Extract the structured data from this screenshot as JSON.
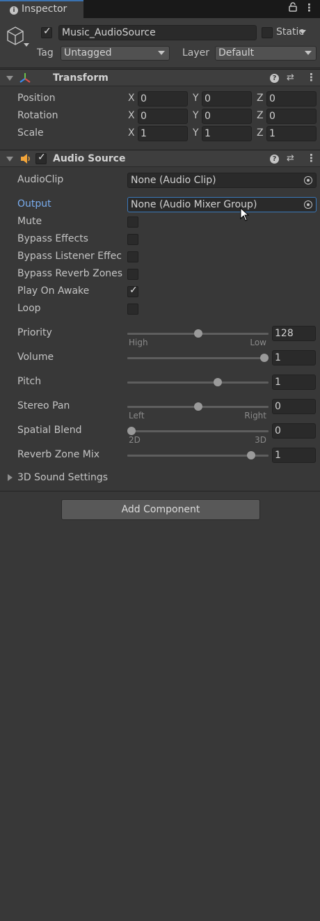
{
  "tab": {
    "title": "Inspector"
  },
  "header": {
    "object_name": "Music_AudioSource",
    "active": true,
    "static_label": "Static",
    "static_checked": false,
    "tag_label": "Tag",
    "tag_value": "Untagged",
    "layer_label": "Layer",
    "layer_value": "Default"
  },
  "transform": {
    "title": "Transform",
    "rows": [
      {
        "label": "Position",
        "x": "0",
        "y": "0",
        "z": "0"
      },
      {
        "label": "Rotation",
        "x": "0",
        "y": "0",
        "z": "0"
      },
      {
        "label": "Scale",
        "x": "1",
        "y": "1",
        "z": "1"
      }
    ],
    "axes": {
      "x": "X",
      "y": "Y",
      "z": "Z"
    }
  },
  "audio_source": {
    "title": "Audio Source",
    "enabled": true,
    "audio_clip": {
      "label": "AudioClip",
      "value": "None (Audio Clip)"
    },
    "output": {
      "label": "Output",
      "value": "None (Audio Mixer Group)"
    },
    "toggles": [
      {
        "label": "Mute",
        "checked": false
      },
      {
        "label": "Bypass Effects",
        "checked": false
      },
      {
        "label": "Bypass Listener Effec",
        "checked": false
      },
      {
        "label": "Bypass Reverb Zones",
        "checked": false
      },
      {
        "label": "Play On Awake",
        "checked": true
      },
      {
        "label": "Loop",
        "checked": false
      }
    ],
    "sliders": [
      {
        "label": "Priority",
        "value": "128",
        "fraction": 0.5,
        "left_caption": "High",
        "right_caption": "Low"
      },
      {
        "label": "Volume",
        "value": "1",
        "fraction": 1.0
      },
      {
        "label": "Pitch",
        "value": "1",
        "fraction": 0.65
      },
      {
        "label": "Stereo Pan",
        "value": "0",
        "fraction": 0.5,
        "left_caption": "Left",
        "right_caption": "Right"
      },
      {
        "label": "Spatial Blend",
        "value": "0",
        "fraction": 0.0,
        "left_caption": "2D",
        "right_caption": "3D"
      },
      {
        "label": "Reverb Zone Mix",
        "value": "1",
        "fraction": 0.9
      }
    ],
    "sound_settings_label": "3D Sound Settings"
  },
  "add_component_label": "Add Component",
  "colors": {
    "accent_blue": "#3a79bb",
    "link_label": "#7aaef0",
    "speaker_icon": "#f2a53a"
  }
}
